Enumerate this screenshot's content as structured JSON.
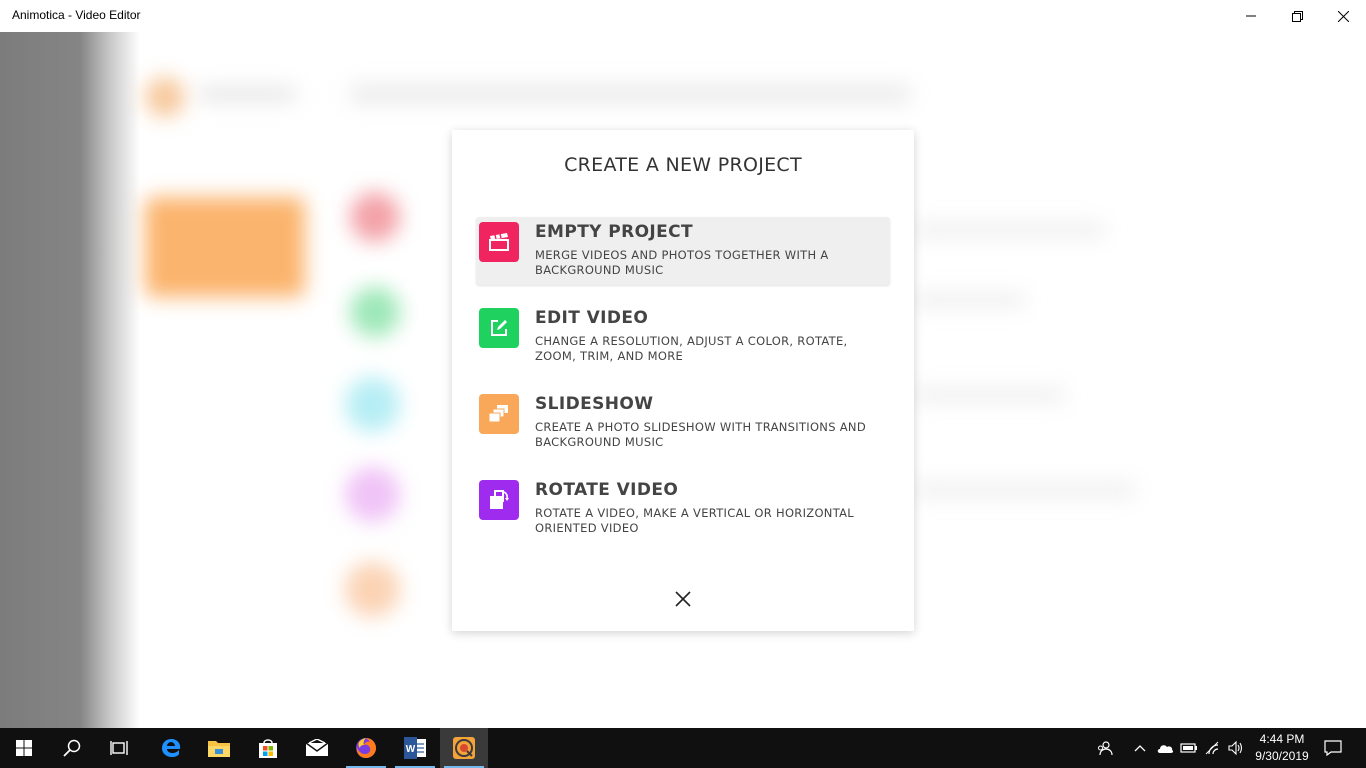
{
  "window": {
    "title": "Animotica - Video Editor",
    "controls": {
      "minimize": "minimize-icon",
      "maximize": "restore-icon",
      "close": "close-icon"
    }
  },
  "dialog": {
    "heading": "CREATE A NEW PROJECT",
    "options": [
      {
        "title": "EMPTY PROJECT",
        "description": "MERGE VIDEOS AND PHOTOS TOGETHER WITH A BACKGROUND MUSIC",
        "icon": "clapperboard-icon",
        "color": "#f0245f",
        "selected": true
      },
      {
        "title": "EDIT VIDEO",
        "description": "CHANGE A RESOLUTION, ADJUST A COLOR, ROTATE, ZOOM, TRIM, AND MORE",
        "icon": "edit-icon",
        "color": "#1fd260",
        "selected": false
      },
      {
        "title": "SLIDESHOW",
        "description": "CREATE A PHOTO SLIDESHOW WITH TRANSITIONS AND BACKGROUND MUSIC",
        "icon": "slides-icon",
        "color": "#f9a85a",
        "selected": false
      },
      {
        "title": "ROTATE VIDEO",
        "description": "ROTATE A VIDEO, MAKE A VERTICAL OR HORIZONTAL ORIENTED VIDEO",
        "icon": "rotate-icon",
        "color": "#9f2bee",
        "selected": false
      }
    ],
    "close_icon": "close-icon"
  },
  "taskbar": {
    "apps": [
      "windows-start-icon",
      "search-icon",
      "task-view-icon",
      "edge-icon",
      "file-explorer-icon",
      "store-icon",
      "mail-icon",
      "firefox-icon",
      "word-icon",
      "animotica-icon"
    ],
    "tray": [
      "people-icon",
      "chevron-up-icon",
      "onedrive-icon",
      "battery-icon",
      "wifi-icon",
      "volume-icon",
      "notifications-icon"
    ],
    "time": "4:44 PM",
    "date": "9/30/2019"
  }
}
